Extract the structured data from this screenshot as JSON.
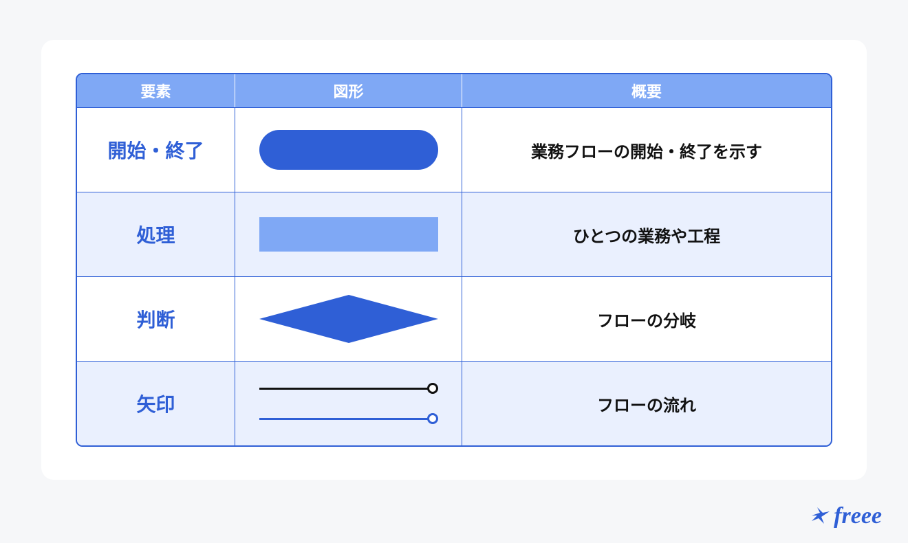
{
  "brand": {
    "name": "freee"
  },
  "table": {
    "headers": {
      "element": "要素",
      "shape": "図形",
      "summary": "概要"
    },
    "rows": [
      {
        "element": "開始・終了",
        "shape_kind": "terminator",
        "summary": "業務フローの開始・終了を示す"
      },
      {
        "element": "処理",
        "shape_kind": "process",
        "summary": "ひとつの業務や工程"
      },
      {
        "element": "判断",
        "shape_kind": "decision",
        "summary": "フローの分岐"
      },
      {
        "element": "矢印",
        "shape_kind": "arrows",
        "summary": "フローの流れ"
      }
    ]
  },
  "colors": {
    "primary": "#2f5fd6",
    "primary_light": "#7fa8f5",
    "row_alt": "#eaf0fe",
    "page_bg": "#f6f7f9"
  }
}
